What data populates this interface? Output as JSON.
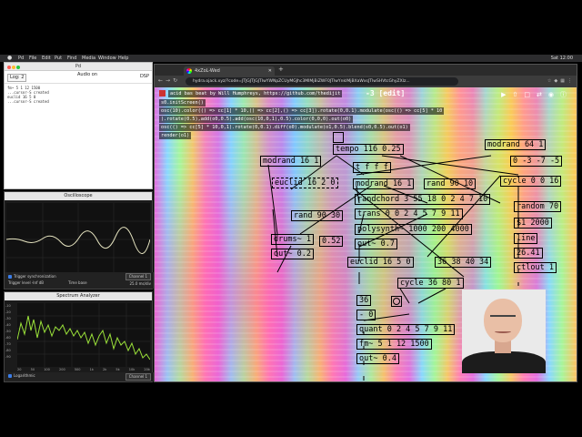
{
  "menubar": {
    "items": [
      "Pd",
      "File",
      "Edit",
      "Put",
      "Find",
      "Media",
      "Window",
      "Help"
    ],
    "clock": "Sat 12:00"
  },
  "pd_console": {
    "title": "Pd",
    "log_label": "Log: 2",
    "audio": "Audio on",
    "dsp": "DSP",
    "lines": [
      "fm~ 5 1 12 1500",
      "...cursor-S created",
      "euclid 16 5 0",
      "...cursor-S created"
    ]
  },
  "oscilloscope": {
    "title": "Oscilloscope",
    "trigger_label": "Trigger synchronization",
    "channel": "Channel 1",
    "trigger_level": "Trigger level",
    "level_value": "-Inf dB",
    "timebase_label": "Time base",
    "timebase_value": "25.0 ms/div"
  },
  "spectrum": {
    "title": "Spectrum Analyzer",
    "y_ticks": [
      "-10",
      "-20",
      "-30",
      "-40",
      "-50",
      "-60",
      "-70",
      "-80",
      "-90"
    ],
    "x_ticks": [
      "20",
      "50",
      "100",
      "200",
      "500",
      "1k",
      "2k",
      "5k",
      "10k",
      "20k"
    ],
    "log_freq": "Logarithmic",
    "channel": "Channel 1"
  },
  "browser": {
    "tab_title": "4xZoL-Wed",
    "url": "hydra.ojack.xyz/?code=JTJGJTJGJTIwYWNpZCUyMGJhc3MlMjBiZWF0JTIwYnklMjBXaWxsJTIwSHVtcGhyZXlz..."
  },
  "hydra": {
    "code_lines": [
      "acid bas beat by Will Humphreys, https://github.com/thedijit",
      "s0.initScreen()",
      "osc(10).color(() => cc[1] * 10,() => cc[2],() => cc[3]).rotate(0,0.1).modulate(osc(() => cc[5] * 10",
      ").rotate(0.5),add(o0,0.5).add(osc(10,0,1),0.5).color(0,0,0).out(o0)",
      "osc(() => cc[5] * 10,0,1).rotate(0,0.1).diff(o0).modulate(o1,0.5).blend(s0,0.5).out(o1)",
      "render(o1)"
    ],
    "edit_link": "-3 [edit]"
  },
  "pd_patch": {
    "objects": [
      {
        "id": "tempo",
        "text": "tempo 116 0.25"
      },
      {
        "id": "modrand64",
        "text": "modrand 64 1"
      },
      {
        "id": "modrand16a",
        "text": "modrand 16 1"
      },
      {
        "id": "ffff",
        "text": "t f f f"
      },
      {
        "id": "range",
        "text": "0 -3 -7 -5"
      },
      {
        "id": "euclid16",
        "text": "euclid 16 2 0"
      },
      {
        "id": "modrand16b",
        "text": "modrand 16 1"
      },
      {
        "id": "rand9010",
        "text": "rand 90 10"
      },
      {
        "id": "cycle",
        "text": "cycle 0 0 16"
      },
      {
        "id": "randchord",
        "text": "randchord 3 55 18 0 2 4 7 10"
      },
      {
        "id": "random70",
        "text": "random 70"
      },
      {
        "id": "rand9030",
        "text": "rand 90 30"
      },
      {
        "id": "trans",
        "text": "trans 0 0 2 4 5 7 9 11"
      },
      {
        "id": "msg2000",
        "text": "$1 2000"
      },
      {
        "id": "polysynth",
        "text": "polysynth~ 1000 200 4000"
      },
      {
        "id": "line",
        "text": "line"
      },
      {
        "id": "drums",
        "text": "drums~ 1"
      },
      {
        "id": "num052",
        "text": "0.52"
      },
      {
        "id": "outa",
        "text": "out~ 0.7"
      },
      {
        "id": "num2641",
        "text": "26.41"
      },
      {
        "id": "outb",
        "text": "out~ 0.2"
      },
      {
        "id": "ctlout",
        "text": "ctlout 1"
      },
      {
        "id": "euclid1650",
        "text": "euclid 16 5 0"
      },
      {
        "id": "list36",
        "text": "36 38 40 34"
      },
      {
        "id": "cycle36",
        "text": "cycle 36 80 1"
      },
      {
        "id": "num36",
        "text": "36"
      },
      {
        "id": "zero",
        "text": "- 0"
      },
      {
        "id": "quant",
        "text": "quant 0 2 4 5 7 9 11"
      },
      {
        "id": "fm",
        "text": "fm~ 5 1 12 1500"
      },
      {
        "id": "outc",
        "text": "out~ 0.4"
      }
    ]
  },
  "colors": {
    "accent": "#3b7de8",
    "spectrum_trace": "#9be23a",
    "scope_trace": "#e6e4c0"
  }
}
